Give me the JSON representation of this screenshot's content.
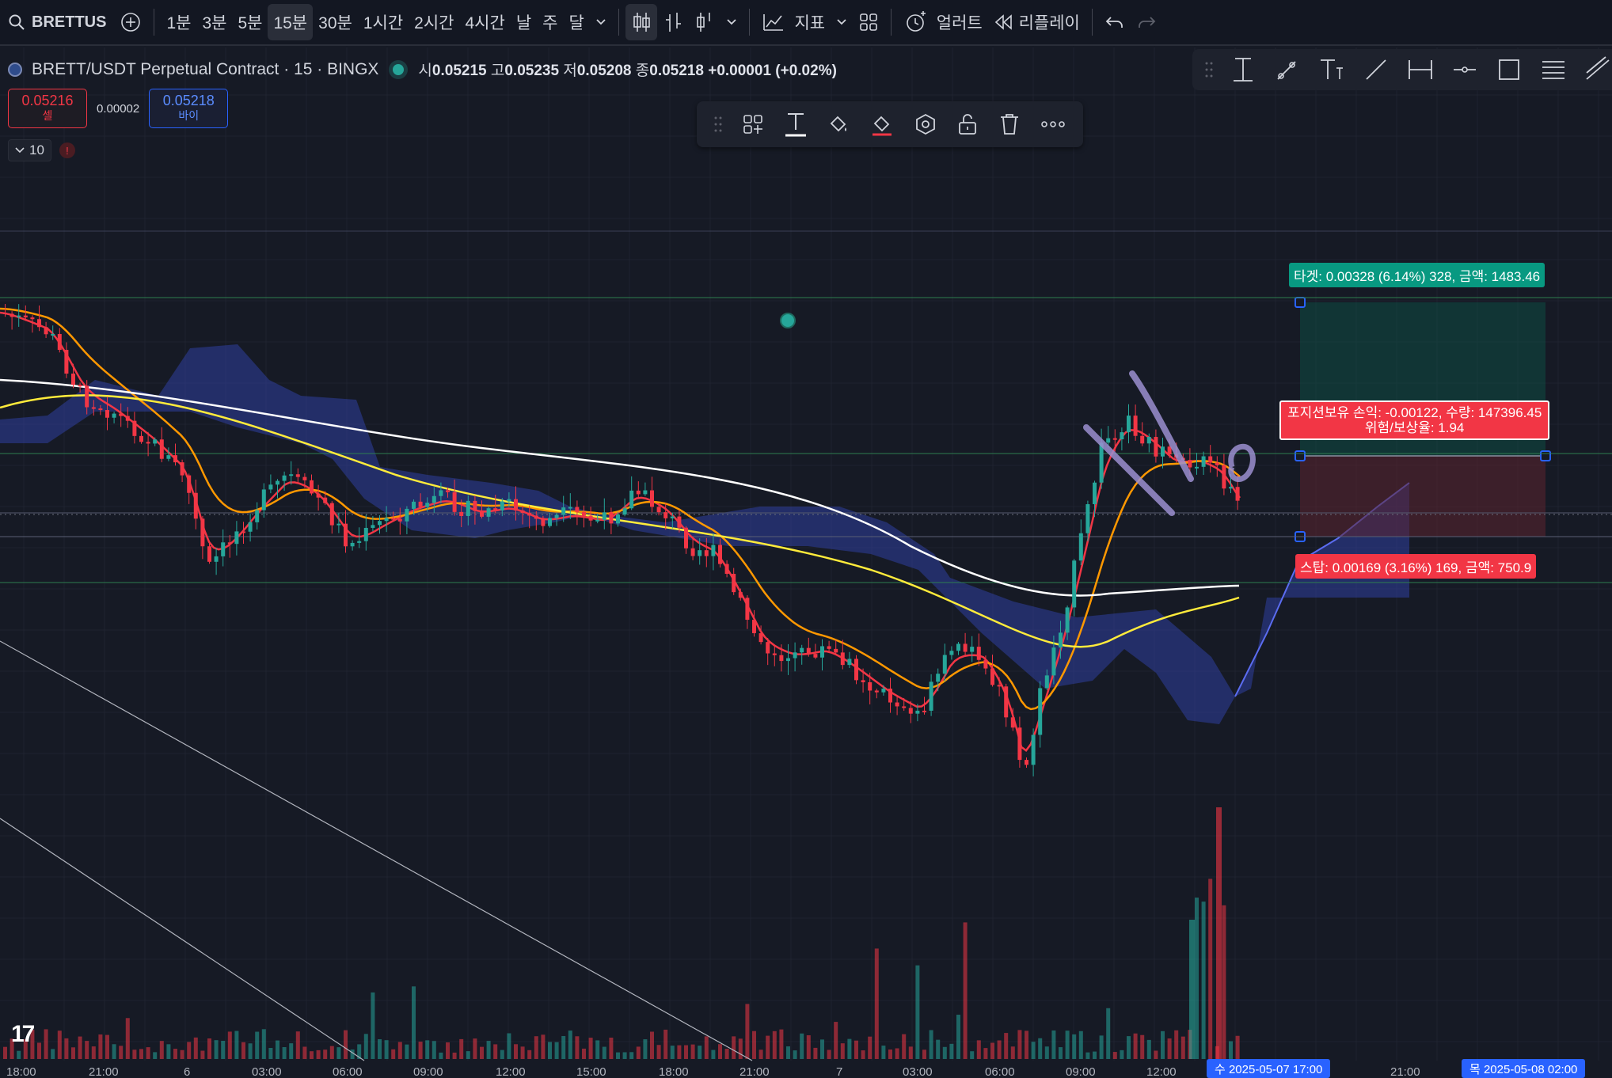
{
  "toolbar": {
    "symbol": "BRETTUS",
    "timeframes": [
      "1분",
      "3분",
      "5분",
      "15분",
      "30분",
      "1시간",
      "2시간",
      "4시간",
      "날",
      "주",
      "달"
    ],
    "active_timeframe": "15분",
    "indicators_label": "지표",
    "alert_label": "얼러트",
    "replay_label": "리플레이"
  },
  "legend": {
    "title": "BRETT/USDT Perpetual Contract · 15 · BINGX",
    "o_label": "시",
    "o": "0.05215",
    "h_label": "고",
    "h": "0.05235",
    "l_label": "저",
    "l": "0.05208",
    "c_label": "종",
    "c": "0.05218",
    "change": "+0.00001 (+0.02%)"
  },
  "trade": {
    "sell_price": "0.05216",
    "sell_label": "셀",
    "spread": "0.00002",
    "buy_price": "0.05218",
    "buy_label": "바이",
    "lots": "10",
    "warn": "!"
  },
  "position": {
    "target_label": "타겟: 0.00328 (6.14%) 328, 금액: 1483.46",
    "pnl_label": "포지션보유 손익: -0.00122, 수량: 147396.45",
    "rr_label": "위험/보상율: 1.94",
    "stop_label": "스탑: 0.00169 (3.16%) 169, 금액: 750.9"
  },
  "xaxis": {
    "ticks": [
      "18:00",
      "21:00",
      "6",
      "03:00",
      "06:00",
      "09:00",
      "12:00",
      "15:00",
      "18:00",
      "21:00",
      "7",
      "03:00",
      "06:00",
      "09:00",
      "12:00",
      "21:00"
    ],
    "cursor_left": "수 2025-05-07 17:00",
    "cursor_right": "목 2025-05-08 02:00"
  },
  "logo": "17",
  "colors": {
    "up": "#26a69a",
    "down": "#f23645",
    "bg": "#161a25",
    "accent": "#2962ff"
  }
}
